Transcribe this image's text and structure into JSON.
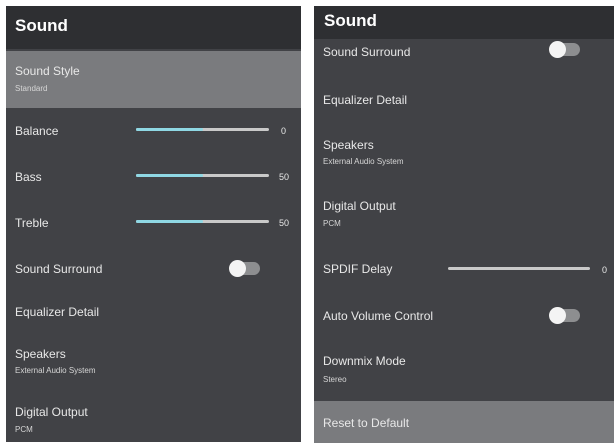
{
  "left_panel": {
    "title": "Sound",
    "sound_style": {
      "label": "Sound Style",
      "value": "Standard"
    },
    "balance": {
      "label": "Balance",
      "value": "0",
      "level": 0.5
    },
    "bass": {
      "label": "Bass",
      "value": "50",
      "level": 0.5
    },
    "treble": {
      "label": "Treble",
      "value": "50",
      "level": 0.5
    },
    "sound_surround": {
      "label": "Sound Surround",
      "state": "off"
    },
    "equalizer_detail": {
      "label": "Equalizer Detail"
    },
    "speakers": {
      "label": "Speakers",
      "value": "External Audio System"
    },
    "digital_output": {
      "label": "Digital Output",
      "value": "PCM"
    }
  },
  "right_panel": {
    "title": "Sound",
    "sound_surround": {
      "label": "Sound Surround",
      "state": "off"
    },
    "equalizer_detail": {
      "label": "Equalizer Detail"
    },
    "speakers": {
      "label": "Speakers",
      "value": "External Audio System"
    },
    "digital_output": {
      "label": "Digital Output",
      "value": "PCM"
    },
    "spdif_delay": {
      "label": "SPDIF Delay",
      "value": "0",
      "level": 0
    },
    "auto_volume_control": {
      "label": "Auto Volume Control",
      "state": "off"
    },
    "downmix_mode": {
      "label": "Downmix Mode",
      "value": "Stereo"
    },
    "reset_to_default": {
      "label": "Reset to Default"
    }
  },
  "colors": {
    "panel_background": "#414246",
    "header_background": "#2e2f32",
    "selected_row": "#7a7b7e",
    "slider_fill": "#8fd8e4",
    "slider_track": "#c9c9c9"
  }
}
